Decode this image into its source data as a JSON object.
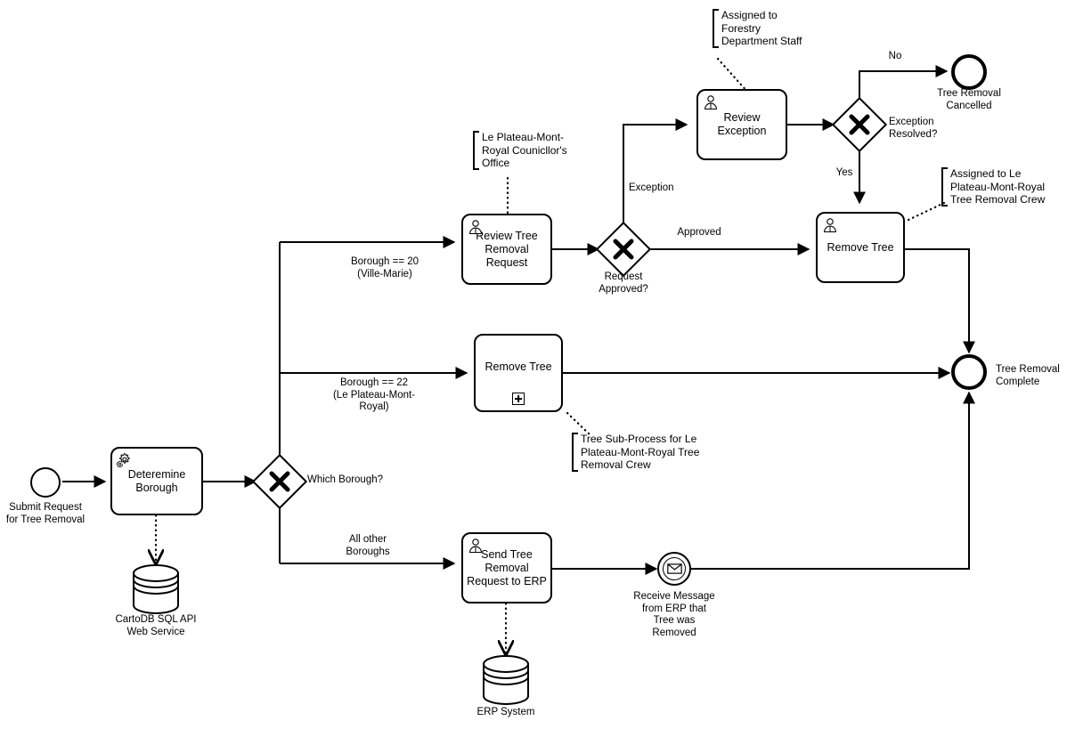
{
  "diagram": {
    "title": "Tree Removal Request Process",
    "notation": "BPMN",
    "background": "#ffffff",
    "stroke": "#000000"
  },
  "events": {
    "start": {
      "label": "Submit Request\nfor Tree Removal",
      "type": "start-event"
    },
    "cancelled": {
      "label": "Tree Removal\nCancelled",
      "type": "end-event"
    },
    "complete": {
      "label": "Tree Removal\nComplete",
      "type": "end-event"
    },
    "message": {
      "label": "Receive Message\nfrom ERP that\nTree was\nRemoved",
      "type": "intermediate-message-event",
      "icon": "envelope-icon"
    }
  },
  "tasks": {
    "determine_borough": {
      "label": "Deteremine\nBorough",
      "icon": "gear-icon",
      "type": "service-task"
    },
    "review_request": {
      "label": "Review Tree\nRemoval\nRequest",
      "icon": "user-icon",
      "type": "user-task"
    },
    "review_exception": {
      "label": "Review\nException",
      "icon": "user-icon",
      "type": "user-task"
    },
    "remove_tree_vm": {
      "label": "Remove Tree",
      "icon": "user-icon",
      "type": "user-task"
    },
    "remove_tree_sub": {
      "label": "Remove Tree",
      "icon": "plus-marker",
      "type": "sub-process"
    },
    "send_to_erp": {
      "label": "Send Tree\nRemoval\nRequest to ERP",
      "icon": "user-icon",
      "type": "user-task"
    }
  },
  "gateways": {
    "which_borough": {
      "label": "Which Borough?",
      "type": "exclusive-gateway"
    },
    "request_approved": {
      "label": "Request\nApproved?",
      "type": "exclusive-gateway"
    },
    "exception_resolved": {
      "label": "Exception\nResolved?",
      "type": "exclusive-gateway"
    }
  },
  "datastores": {
    "cartodb": {
      "label": "CartoDB SQL API\nWeb Service"
    },
    "erp": {
      "label": "ERP System"
    }
  },
  "flow_labels": {
    "borough_20": "Borough == 20\n(Ville-Marie)",
    "borough_22": "Borough == 22\n(Le Plateau-Mont-\nRoyal)",
    "all_other": "All other\nBoroughs",
    "exception": "Exception",
    "approved": "Approved",
    "no": "No",
    "yes": "Yes"
  },
  "annotations": {
    "forestry": "Assigned to\nForestry\nDepartment Staff",
    "councillor": "Le Plateau-Mont-\nRoyal Counicllor's\nOffice",
    "crew": "Assigned to Le\nPlateau-Mont-Royal\nTree Removal Crew",
    "subprocess": "Tree Sub-Process for Le\nPlateau-Mont-Royal Tree\nRemoval Crew"
  }
}
